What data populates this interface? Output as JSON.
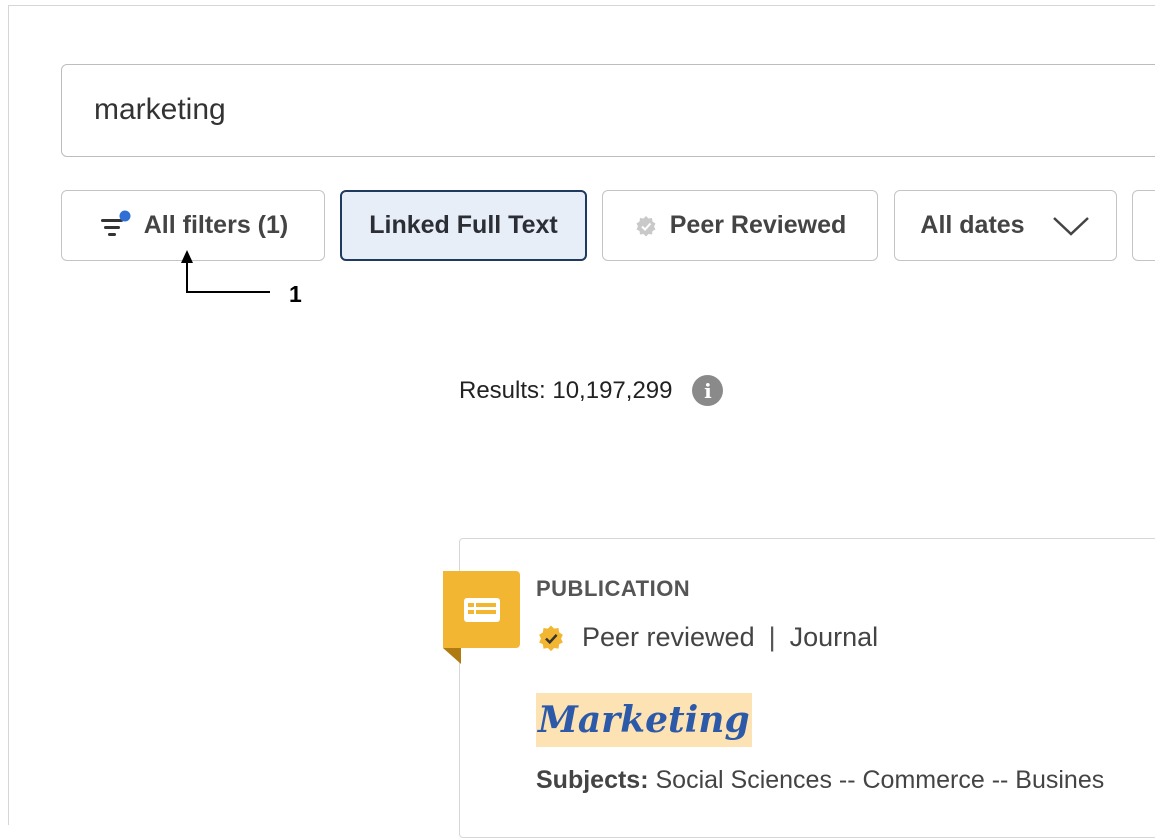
{
  "search": {
    "query": "marketing"
  },
  "filters": {
    "all_filters": "All filters (1)",
    "linked_full_text": "Linked Full Text",
    "peer_reviewed": "Peer Reviewed",
    "all_dates": "All dates"
  },
  "annotation": {
    "number": "1"
  },
  "results": {
    "label": "Results: 10,197,299",
    "info_glyph": "i"
  },
  "record": {
    "type": "PUBLICATION",
    "peer_reviewed": "Peer reviewed",
    "separator": "|",
    "format": "Journal",
    "title": "Marketing",
    "subjects_label": "Subjects:",
    "subjects_value": "Social Sciences -- Commerce -- Busines"
  },
  "colors": {
    "accent_blue": "#2d5aa8",
    "badge_gold": "#f2b632",
    "active_chip_border": "#1f3a5f",
    "highlight": "#fde2b4"
  }
}
